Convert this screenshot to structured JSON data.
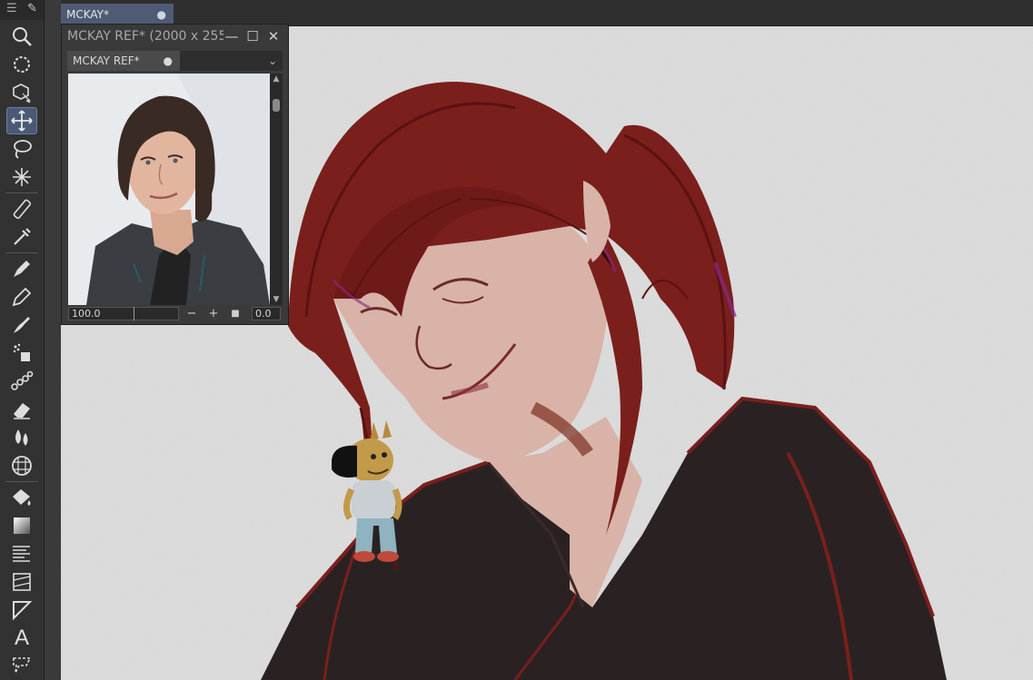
{
  "app": {
    "document_tab": {
      "label": "MCKAY*",
      "modified_marker": "●"
    }
  },
  "reference_window": {
    "title": "MCKAY REF* (2000 x 255",
    "tab_label": "MCKAY REF*",
    "tab_marker": "●",
    "minimize": "—",
    "maximize": "☐",
    "close": "✕",
    "zoom_value": "100.0",
    "zoom_out": "−",
    "zoom_in": "+",
    "reset": "■",
    "rotation_value": "0.0"
  },
  "toolbar": {
    "tools": [
      {
        "name": "zoom-tool-icon",
        "active": false
      },
      {
        "name": "rotate-tool-icon",
        "active": false
      },
      {
        "name": "object-tool-icon",
        "active": false
      },
      {
        "name": "move-tool-icon",
        "active": true
      },
      {
        "name": "lasso-tool-icon",
        "active": false
      },
      {
        "name": "auto-select-tool-icon",
        "active": false
      },
      {
        "name": "ruler-tool-icon",
        "active": false
      },
      {
        "name": "eyedropper-tool-icon",
        "active": false
      },
      {
        "name": "pen-tool-icon",
        "active": false
      },
      {
        "name": "pencil-tool-icon",
        "active": false
      },
      {
        "name": "brush-tool-icon",
        "active": false
      },
      {
        "name": "airbrush-tool-icon",
        "active": false
      },
      {
        "name": "decoration-tool-icon",
        "active": false
      },
      {
        "name": "eraser-tool-icon",
        "active": false
      },
      {
        "name": "blend-tool-icon",
        "active": false
      },
      {
        "name": "frame-tool-icon",
        "active": false
      },
      {
        "name": "fill-tool-icon",
        "active": false
      },
      {
        "name": "gradient-tool-icon",
        "active": false
      },
      {
        "name": "effect-line-tool-icon",
        "active": false
      },
      {
        "name": "figure-tool-icon",
        "active": false
      },
      {
        "name": "ruler-line-tool-icon",
        "active": false
      },
      {
        "name": "text-tool-icon",
        "active": false
      },
      {
        "name": "balloon-tool-icon",
        "active": false
      }
    ],
    "text_tool_glyph": "A"
  },
  "colors": {
    "canvas_paper": "#dcdcdc",
    "hair": "#7a1f1c",
    "hair_line": "#5a1212",
    "skin": "#d9b3a8",
    "hoodie": "#2a2222",
    "accent_tab": "#4f5b74"
  }
}
